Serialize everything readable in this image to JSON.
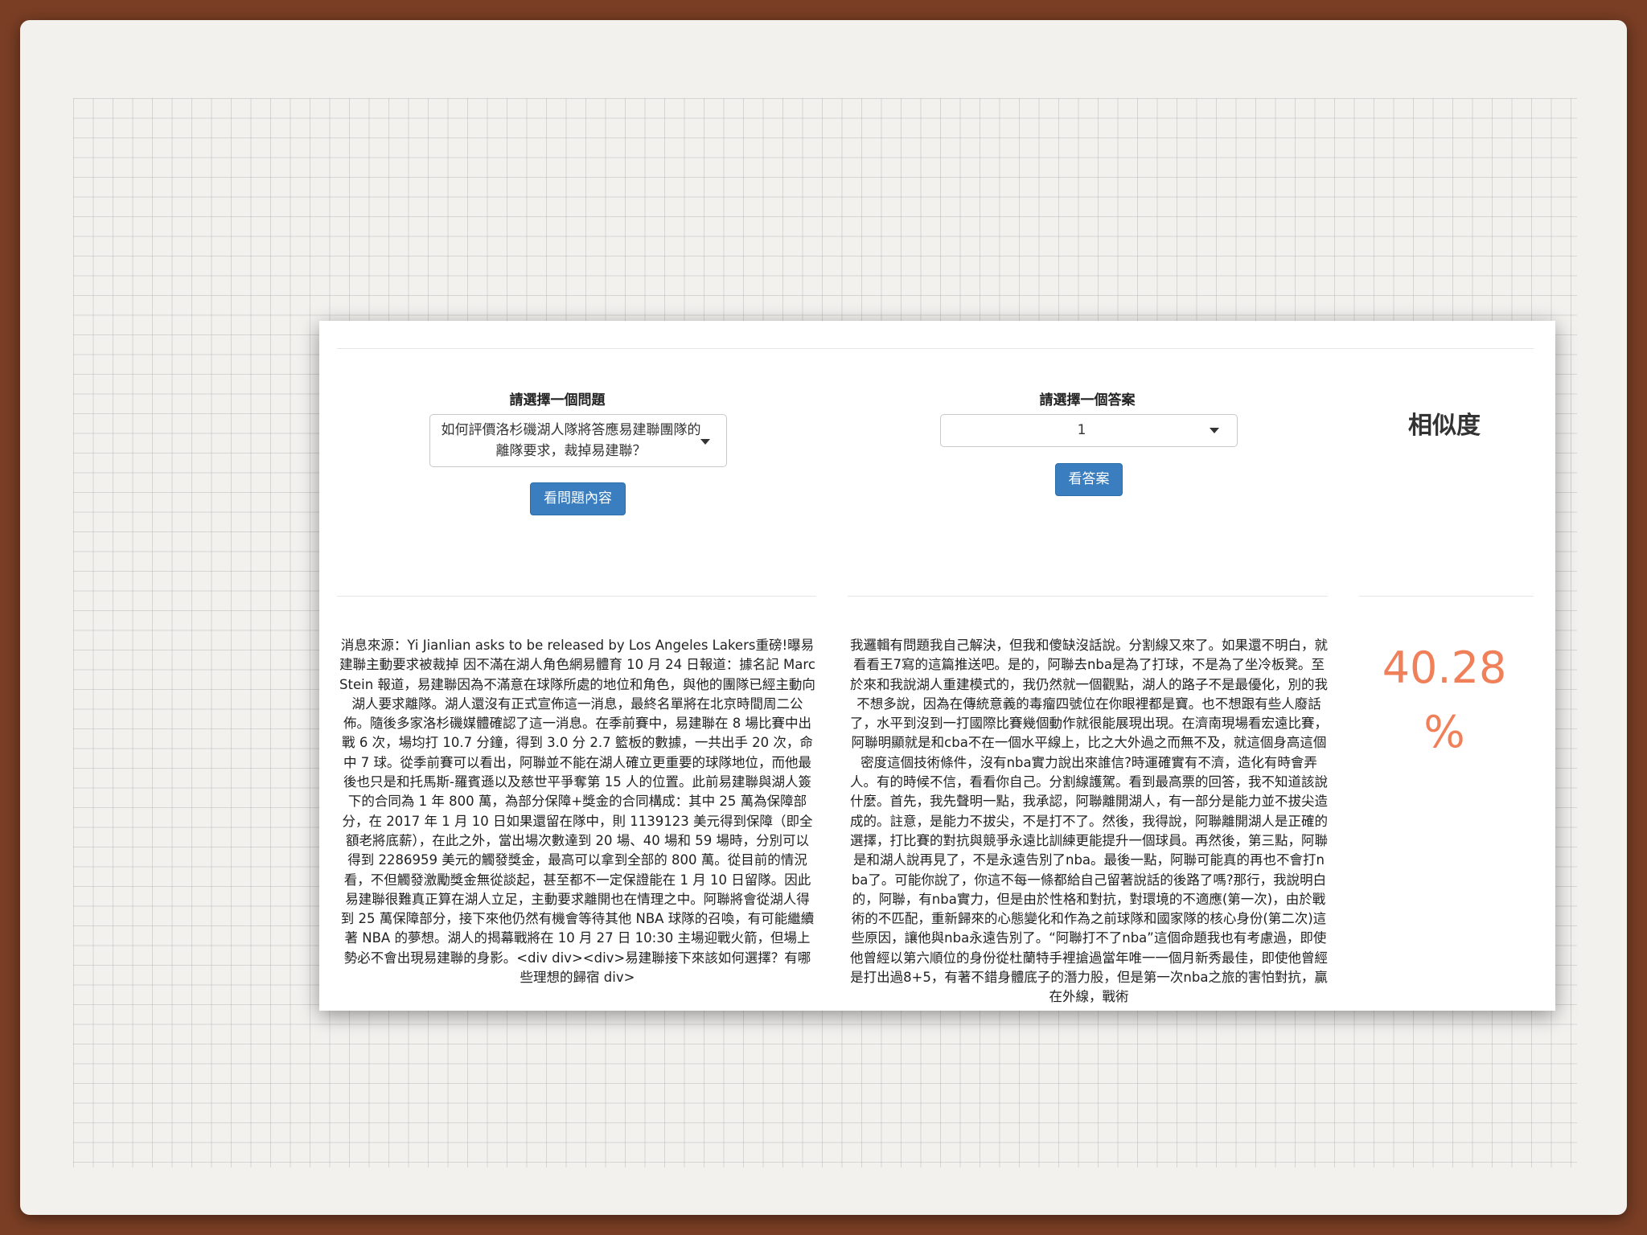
{
  "question_panel": {
    "label": "請選擇一個問題",
    "selected_question": "如何評價洛杉磯湖人隊將答應易建聯團隊的離隊要求，裁掉易建聯？",
    "view_button": "看問題內容"
  },
  "answer_panel": {
    "label": "請選擇一個答案",
    "selected_answer": "1",
    "view_button": "看答案"
  },
  "similarity": {
    "title": "相似度",
    "value": "40.28",
    "unit": "%"
  },
  "question_content": "消息來源：Yi Jianlian asks to be released by Los Angeles Lakers重磅!曝易建聯主動要求被裁掉 因不滿在湖人角色網易體育 10 月 24 日報道：據名記 Marc Stein 報道，易建聯因為不滿意在球隊所處的地位和角色，與他的團隊已經主動向湖人要求離隊。湖人還沒有正式宣佈這一消息，最終名單將在北京時間周二公佈。隨後多家洛杉磯媒體確認了這一消息。在季前賽中，易建聯在 8 場比賽中出戰 6 次，場均打 10.7 分鐘，得到 3.0 分 2.7 籃板的數據，一共出手 20 次，命中 7 球。從季前賽可以看出，阿聯並不能在湖人確立更重要的球隊地位，而他最後也只是和托馬斯-羅賓遜以及慈世平爭奪第 15 人的位置。此前易建聯與湖人簽下的合同為 1 年 800 萬，為部分保障+獎金的合同構成：其中 25 萬為保障部分，在 2017 年 1 月 10 日如果還留在隊中，則 1139123 美元得到保障（即全額老將底薪），在此之外，當出場次數達到 20 場、40 場和 59 場時，分別可以得到 2286959 美元的觸發獎金，最高可以拿到全部的 800 萬。從目前的情況看，不但觸發激勵獎金無從談起，甚至都不一定保證能在 1 月 10 日留隊。因此易建聯很難真正算在湖人立足，主動要求離開也在情理之中。阿聯將會從湖人得到 25 萬保障部分，接下來他仍然有機會等待其他 NBA 球隊的召喚，有可能繼續著 NBA 的夢想。湖人的揭幕戰將在 10 月 27 日 10:30 主場迎戰火箭，但場上勢必不會出現易建聯的身影。<div div><div>易建聯接下來該如何選擇？有哪些理想的歸宿 div>",
  "answer_content": "我邏輯有問題我自己解決，但我和傻缺沒話說。分割線又來了。如果還不明白，就看看王7寫的這篇推送吧。是的，阿聯去nba是為了打球，不是為了坐冷板凳。至於來和我說湖人重建模式的，我仍然就一個觀點，湖人的路子不是最優化，別的我不想多說，因為在傳統意義的毒瘤四號位在你眼裡都是寶。也不想跟有些人廢話了，水平到沒到一打國際比賽幾個動作就很能展現出現。在濟南現場看宏遠比賽，阿聯明顯就是和cba不在一個水平線上，比之大外過之而無不及，就這個身高這個密度這個技術條件，沒有nba實力說出來誰信?時運確實有不濟，造化有時會弄人。有的時候不信，看看你自己。分割線護駕。看到最高票的回答，我不知道該說什麼。首先，我先聲明一點，我承認，阿聯離開湖人，有一部分是能力並不拔尖造成的。註意，是能力不拔尖，不是打不了。然後，我得說，阿聯離開湖人是正確的選擇，打比賽的對抗與競爭永遠比訓練更能提升一個球員。再然後，第三點，阿聯是和湖人說再見了，不是永遠告別了nba。最後一點，阿聯可能真的再也不會打nba了。可能你說了，你這不每一條都給自己留著說話的後路了嗎?那行，我說明白的，阿聯，有nba實力，但是由於性格和對抗，對環境的不適應(第一次)，由於戰術的不匹配，重新歸來的心態變化和作為之前球隊和國家隊的核心身份(第二次)這些原因，讓他與nba永遠告別了。“阿聯打不了nba”這個命題我也有考慮過，即使他曾經以第六順位的身份從杜蘭特手裡搶過當年唯一一個月新秀最佳，即使他曾經是打出過8+5，有著不錯身體底子的潛力股，但是第一次nba之旅的害怕對抗，贏在外線，戰術"
}
